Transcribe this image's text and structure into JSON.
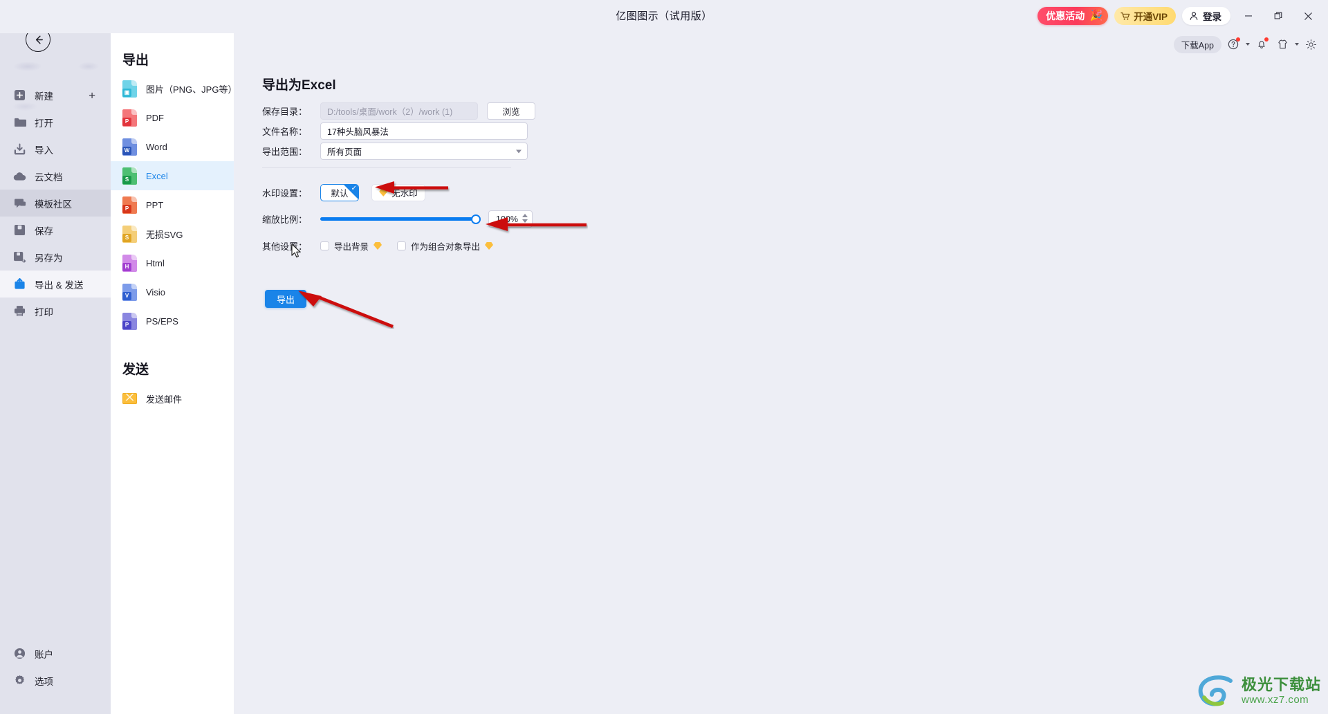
{
  "window": {
    "title": "亿图图示（试用版）",
    "controls": {
      "minimize": "—",
      "maximize": "❐",
      "close": "✕"
    }
  },
  "topbar": {
    "promo_label": "优惠活动",
    "vip_label": "开通VIP",
    "login_label": "登录",
    "download_app_label": "下载App",
    "icons": [
      "help-icon",
      "bell-icon",
      "skin-icon",
      "gear-icon"
    ]
  },
  "sidebar": {
    "back_icon": "back-arrow-icon",
    "items": [
      {
        "label": "新建",
        "icon": "new-file-icon",
        "state": "normal",
        "trailing": "+"
      },
      {
        "label": "打开",
        "icon": "folder-icon",
        "state": "normal"
      },
      {
        "label": "导入",
        "icon": "import-icon",
        "state": "normal"
      },
      {
        "label": "云文档",
        "icon": "cloud-icon",
        "state": "normal"
      },
      {
        "label": "模板社区",
        "icon": "community-icon",
        "state": "hover"
      },
      {
        "label": "保存",
        "icon": "save-icon",
        "state": "normal"
      },
      {
        "label": "另存为",
        "icon": "save-as-icon",
        "state": "normal"
      },
      {
        "label": "导出 & 发送",
        "icon": "export-icon",
        "state": "active"
      },
      {
        "label": "打印",
        "icon": "printer-icon",
        "state": "normal"
      }
    ],
    "bottom_items": [
      {
        "label": "账户",
        "icon": "account-icon"
      },
      {
        "label": "选项",
        "icon": "options-icon"
      }
    ]
  },
  "export_column": {
    "export_heading": "导出",
    "formats": [
      {
        "label": "图片（PNG、JPG等）",
        "icon": "image-file-icon",
        "tag": "",
        "color": "#6fd3e8",
        "tagcolor": "#2fb8d6",
        "selected": false
      },
      {
        "label": "PDF",
        "icon": "pdf-file-icon",
        "tag": "P",
        "color": "#f4767a",
        "tagcolor": "#e2343c",
        "selected": false
      },
      {
        "label": "Word",
        "icon": "word-file-icon",
        "tag": "W",
        "color": "#6f8fe0",
        "tagcolor": "#2a55b8",
        "selected": false
      },
      {
        "label": "Excel",
        "icon": "excel-file-icon",
        "tag": "S",
        "color": "#4dbf72",
        "tagcolor": "#1a9a4a",
        "selected": true
      },
      {
        "label": "PPT",
        "icon": "ppt-file-icon",
        "tag": "P",
        "color": "#ef7a50",
        "tagcolor": "#d8371b",
        "selected": false
      },
      {
        "label": "无损SVG",
        "icon": "svg-file-icon",
        "tag": "S",
        "color": "#f4ce78",
        "tagcolor": "#e0a524",
        "selected": false
      },
      {
        "label": "Html",
        "icon": "html-file-icon",
        "tag": "H",
        "color": "#d18ae8",
        "tagcolor": "#a23ed0",
        "selected": false
      },
      {
        "label": "Visio",
        "icon": "visio-file-icon",
        "tag": "V",
        "color": "#7d9cea",
        "tagcolor": "#2f5fd0",
        "selected": false
      },
      {
        "label": "PS/EPS",
        "icon": "ps-file-icon",
        "tag": "P",
        "color": "#8a86e0",
        "tagcolor": "#4c45c8",
        "selected": false
      }
    ],
    "send_heading": "发送",
    "send_items": [
      {
        "label": "发送邮件",
        "icon": "mail-icon"
      }
    ]
  },
  "main": {
    "page_title": "导出为Excel",
    "fields": {
      "save_dir": {
        "label": "保存目录：",
        "value": "D:/tools/桌面/work（2）/work (1)",
        "readonly": true,
        "browse_label": "浏览"
      },
      "file_name": {
        "label": "文件名称：",
        "value": "17种头脑风暴法"
      },
      "export_range": {
        "label": "导出范围：",
        "value": "所有页面"
      }
    },
    "watermark": {
      "label": "水印设置：",
      "options": [
        {
          "label": "默认",
          "selected": true,
          "has_vip_badge": false
        },
        {
          "label": "无水印",
          "selected": false,
          "has_vip_badge": true
        }
      ]
    },
    "scale": {
      "label": "缩放比例：",
      "value": "100%",
      "percent": 100,
      "min": 0,
      "max": 100
    },
    "other": {
      "label": "其他设置：",
      "checkboxes": [
        {
          "label": "导出背景",
          "checked": false,
          "has_vip_badge": true
        },
        {
          "label": "作为组合对象导出",
          "checked": false,
          "has_vip_badge": true
        }
      ]
    },
    "export_button": "导出"
  },
  "watermark_logo": {
    "title": "极光下载站",
    "url": "www.xz7.com"
  },
  "colors": {
    "accent": "#1a84e8",
    "app_bg": "#edeef5",
    "sidebar_bg": "#e1e2ec",
    "panel_bg": "#ffffff",
    "selected_row": "#e4f1fd",
    "annotation_red": "#cc1111",
    "vip_gold": "#fbbe3c"
  }
}
